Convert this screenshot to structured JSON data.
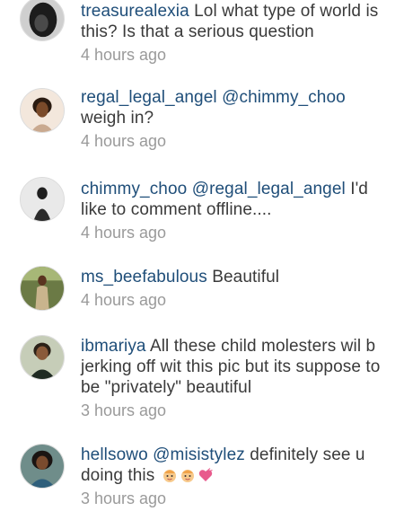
{
  "comments": [
    {
      "username": "treasurealexia",
      "body": " Lol what type of world is this? Is that a serious question",
      "time": "4 hours ago",
      "avatar_icon": "avatar-photo"
    },
    {
      "username": "regal_legal_angel",
      "mention": "@chimmy_choo",
      "body": " weigh in?",
      "time": "4 hours ago",
      "avatar_icon": "avatar-photo"
    },
    {
      "username": "chimmy_choo",
      "mention": "@regal_legal_angel",
      "body": " I'd like to comment offline....",
      "time": "4 hours ago",
      "avatar_icon": "avatar-photo"
    },
    {
      "username": "ms_beefabulous",
      "body": " Beautiful",
      "time": "4 hours ago",
      "avatar_icon": "avatar-photo"
    },
    {
      "username": "ibmariya",
      "body": " All these child molesters wil b jerking off wit this pic but its suppose to be \"privately\" beautiful",
      "time": "3 hours ago",
      "avatar_icon": "avatar-photo"
    },
    {
      "username": "hellsowo",
      "mention": "@misistylez",
      "body": " definitely see u doing this ",
      "time": "3 hours ago",
      "avatar_icon": "avatar-photo",
      "emojis": [
        "baby-face-emoji",
        "baby-face-emoji",
        "heart-emoji"
      ]
    }
  ],
  "colors": {
    "username": "#1f4e79",
    "text": "#3a3a3a",
    "timestamp": "#9a9a9a"
  }
}
